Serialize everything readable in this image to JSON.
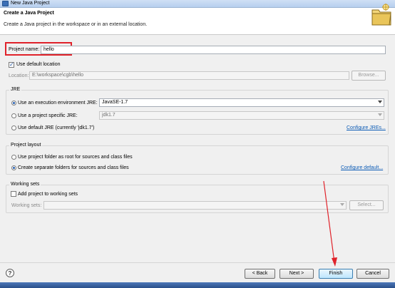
{
  "window": {
    "title": "New Java Project"
  },
  "header": {
    "title": "Create a Java Project",
    "description": "Create a Java project in the workspace or in an external location."
  },
  "project": {
    "name_label": "Project name:",
    "name_value": "hello"
  },
  "location": {
    "use_default_label": "Use default location",
    "use_default_checked": true,
    "location_label": "Location:",
    "location_value": "E:\\workspace\\cgb\\hello",
    "browse_label": "Browse..."
  },
  "jre": {
    "group_title": "JRE",
    "options": [
      {
        "label": "Use an execution environment JRE:",
        "selected": true,
        "value": "JavaSE-1.7"
      },
      {
        "label": "Use a project specific JRE:",
        "selected": false,
        "value": "jdk1.7"
      },
      {
        "label": "Use default JRE (currently 'jdk1.7')",
        "selected": false
      }
    ],
    "configure_link": "Configure JREs..."
  },
  "layout": {
    "group_title": "Project layout",
    "options": [
      {
        "label": "Use project folder as root for sources and class files",
        "selected": false
      },
      {
        "label": "Create separate folders for sources and class files",
        "selected": true
      }
    ],
    "configure_link": "Configure default..."
  },
  "working_sets": {
    "group_title": "Working sets",
    "add_label": "Add project to working sets",
    "add_checked": false,
    "sets_label": "Working sets:",
    "select_label": "Select..."
  },
  "footer": {
    "help_icon": "?",
    "back_label": "< Back",
    "next_label": "Next >",
    "finish_label": "Finish",
    "cancel_label": "Cancel"
  },
  "colors": {
    "annotation_red": "#e0222a",
    "link_blue": "#0b5bb5"
  }
}
